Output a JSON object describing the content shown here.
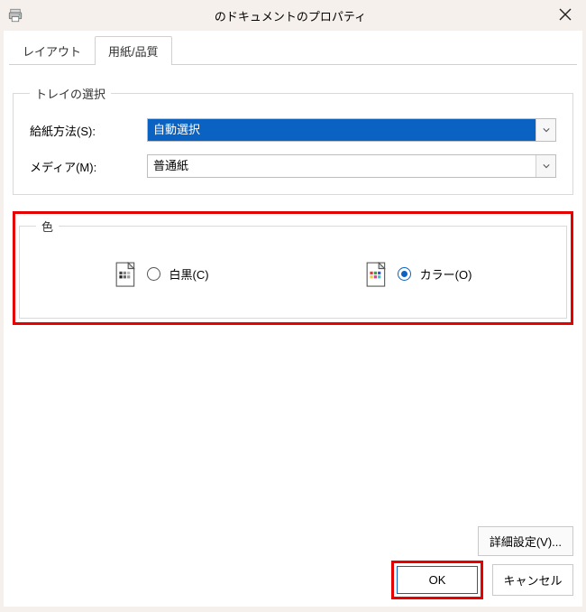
{
  "titlebar": {
    "title": "のドキュメントのプロパティ"
  },
  "tabs": {
    "layout": "レイアウト",
    "paper": "用紙/品質"
  },
  "tray": {
    "legend": "トレイの選択",
    "paper_source_label": "給紙方法(S):",
    "paper_source_value": "自動選択",
    "media_label": "メディア(M):",
    "media_value": "普通紙"
  },
  "color": {
    "legend": "色",
    "bw_label": "白黒(C)",
    "color_label": "カラー(O)"
  },
  "buttons": {
    "advanced": "詳細設定(V)...",
    "ok": "OK",
    "cancel": "キャンセル"
  }
}
